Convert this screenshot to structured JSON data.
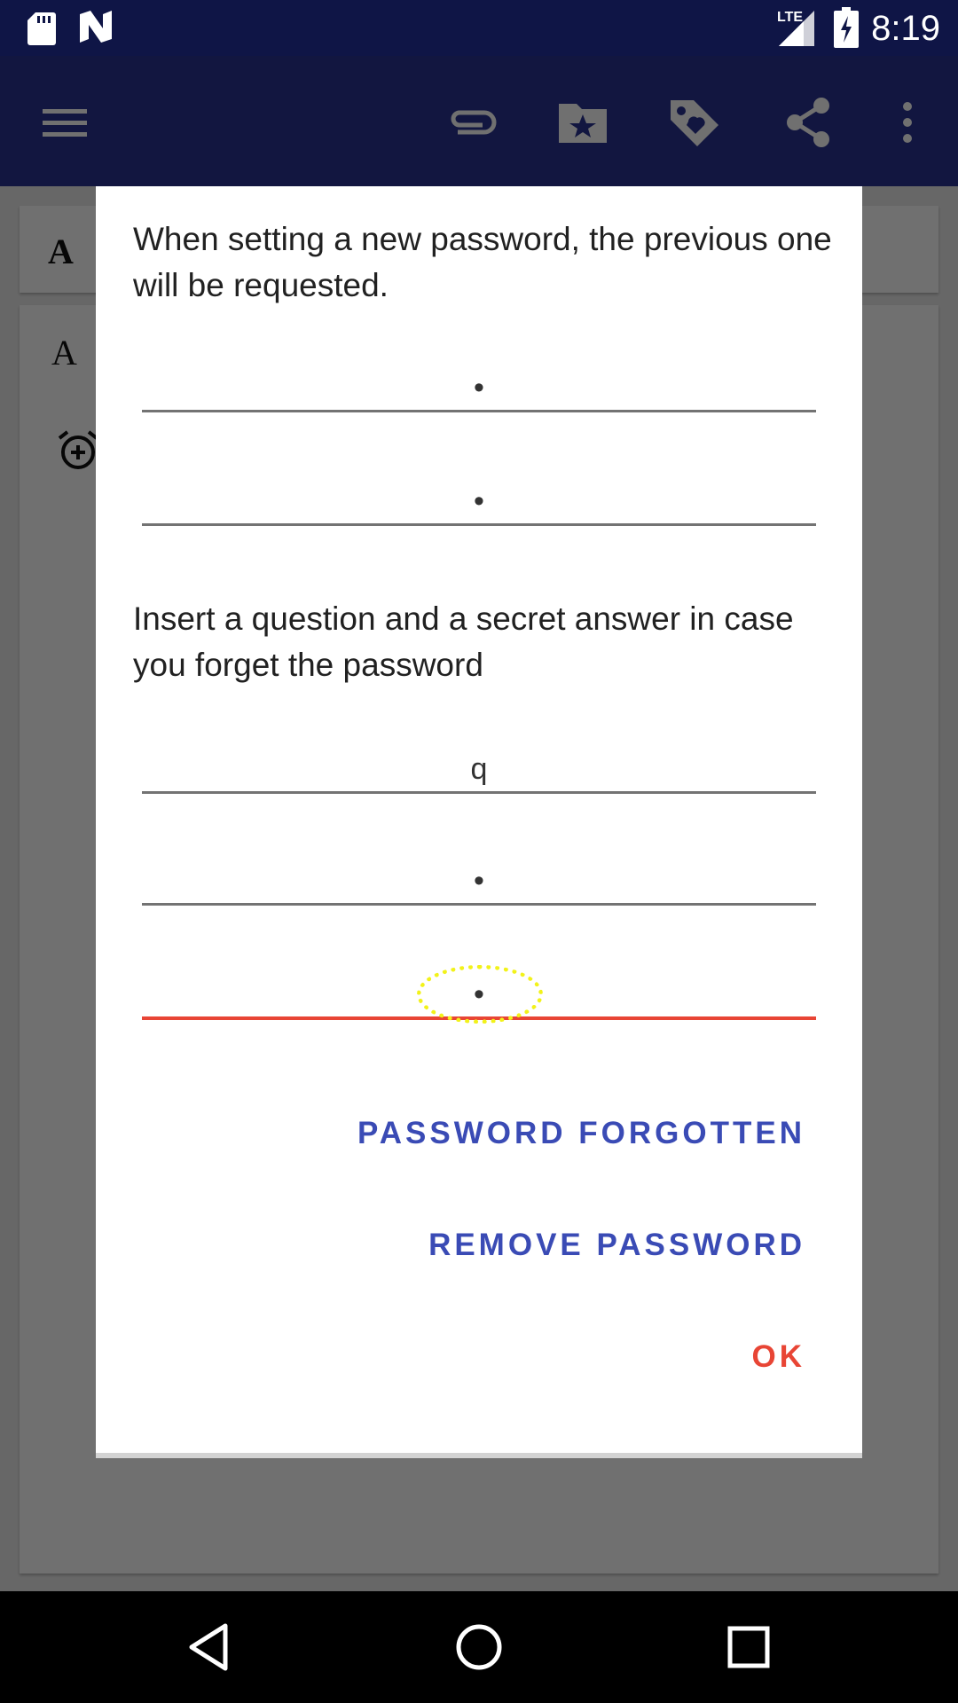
{
  "status_bar": {
    "network": "LTE",
    "time": "8:19"
  },
  "background_cards": {
    "card1_letter": "A",
    "card2_letter": "A"
  },
  "dialog": {
    "message1": "When setting a new password, the previous one will be requested.",
    "password_field_1": "•",
    "password_field_2": "•",
    "message2": "Insert a question and a secret answer in case you forget the password",
    "question_field": "q",
    "answer_field_1": "•",
    "answer_field_2": "•",
    "buttons": {
      "password_forgotten": "PASSWORD FORGOTTEN",
      "remove_password": "REMOVE PASSWORD",
      "ok": "OK"
    }
  },
  "colors": {
    "status_bar": "#0f1546",
    "app_bar": "#2a3491",
    "accent": "#e84535",
    "button_text": "#3a4bb5"
  },
  "icons": [
    "sd-card-icon",
    "n-notification-icon",
    "signal-icon",
    "battery-charging-icon",
    "menu-icon",
    "attachment-icon",
    "folder-star-icon",
    "tag-icon",
    "share-icon",
    "more-vert-icon",
    "alarm-add-icon",
    "back-icon",
    "home-icon",
    "recents-icon"
  ]
}
